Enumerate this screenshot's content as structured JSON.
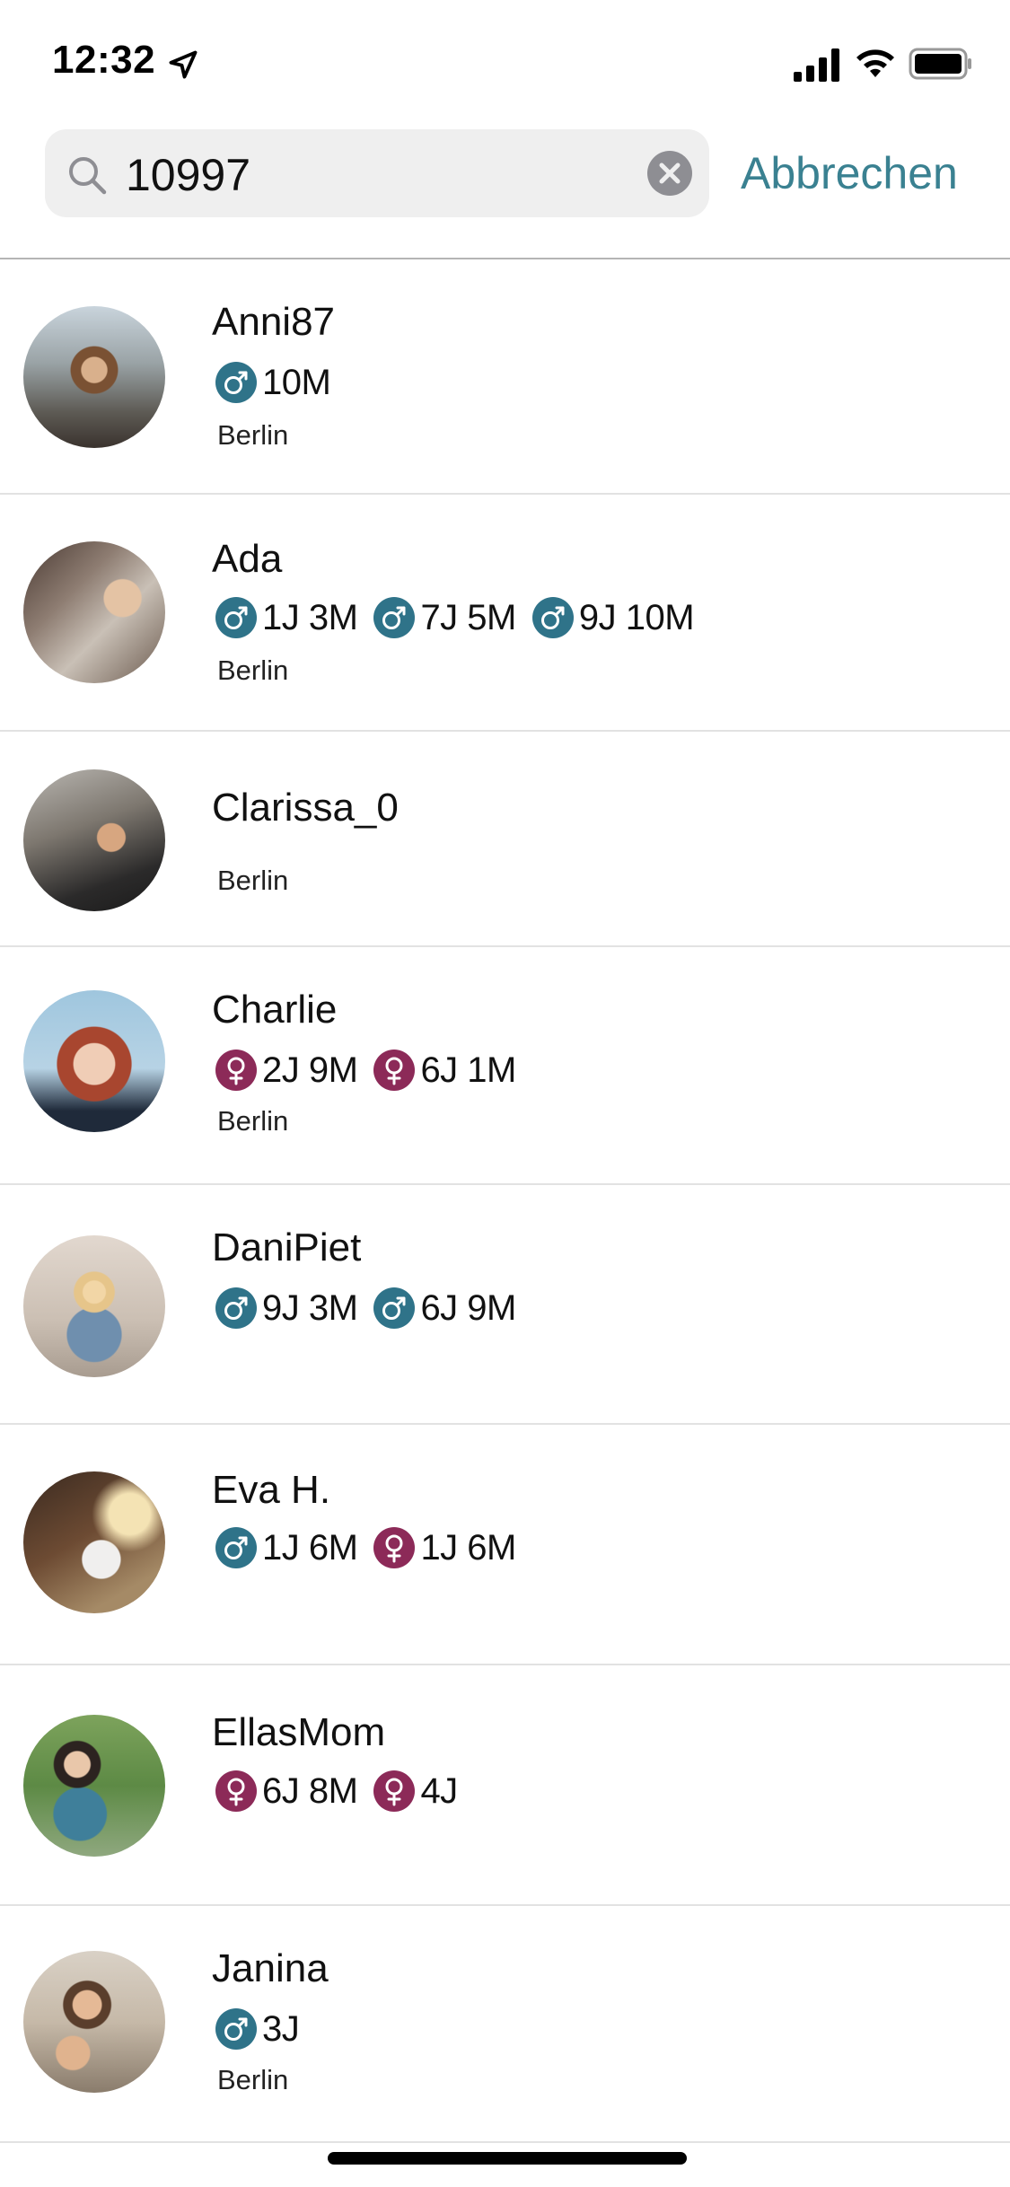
{
  "status_bar": {
    "time": "12:32",
    "icons": [
      "location-arrow-icon",
      "signal-icon",
      "wifi-icon",
      "battery-icon"
    ]
  },
  "search": {
    "query": "10997",
    "cancel_label": "Abbrechen",
    "icons": [
      "search-icon",
      "clear-icon"
    ]
  },
  "colors": {
    "accent": "#3a8191",
    "male_badge": "#2f7389",
    "female_badge": "#8c2a58",
    "search_bg": "#efefef"
  },
  "users": [
    {
      "name": "Anni87",
      "city": "Berlin",
      "kids": [
        {
          "gender": "male",
          "age": "10M"
        }
      ]
    },
    {
      "name": "Ada",
      "city": "Berlin",
      "kids": [
        {
          "gender": "male",
          "age": "1J 3M"
        },
        {
          "gender": "male",
          "age": "7J 5M"
        },
        {
          "gender": "male",
          "age": "9J 10M"
        }
      ]
    },
    {
      "name": "Clarissa_0",
      "city": "Berlin",
      "kids": []
    },
    {
      "name": "Charlie",
      "city": "Berlin",
      "kids": [
        {
          "gender": "female",
          "age": "2J 9M"
        },
        {
          "gender": "female",
          "age": "6J 1M"
        }
      ]
    },
    {
      "name": "DaniPiet",
      "city": "",
      "kids": [
        {
          "gender": "male",
          "age": "9J 3M"
        },
        {
          "gender": "male",
          "age": "6J 9M"
        }
      ]
    },
    {
      "name": "Eva H.",
      "city": "",
      "kids": [
        {
          "gender": "male",
          "age": "1J 6M"
        },
        {
          "gender": "female",
          "age": "1J 6M"
        }
      ]
    },
    {
      "name": "EllasMom",
      "city": "",
      "kids": [
        {
          "gender": "female",
          "age": "6J 8M"
        },
        {
          "gender": "female",
          "age": "4J"
        }
      ]
    },
    {
      "name": "Janina",
      "city": "Berlin",
      "kids": [
        {
          "gender": "male",
          "age": "3J"
        }
      ]
    }
  ]
}
